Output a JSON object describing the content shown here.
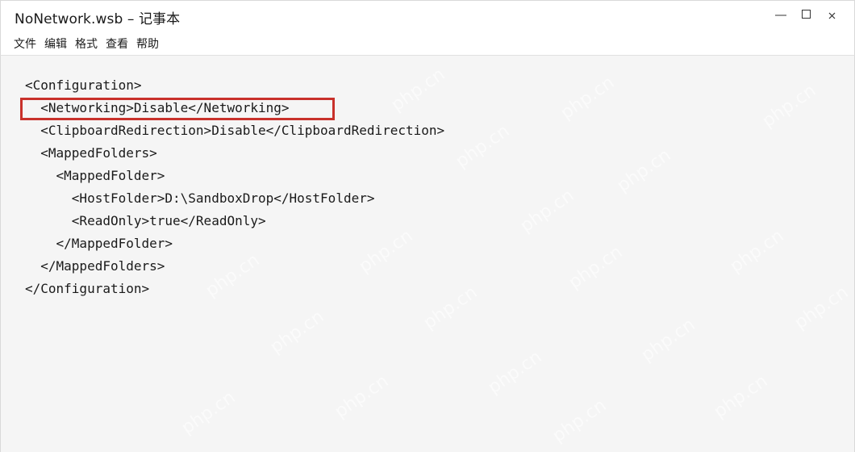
{
  "window": {
    "title": "NoNetwork.wsb – 记事本",
    "controls": {
      "minimize": "—",
      "maximize": "☐",
      "close": "✕"
    }
  },
  "menu": {
    "items": [
      "文件",
      "编辑",
      "格式",
      "查看",
      "帮助"
    ]
  },
  "editor": {
    "lines": [
      "<Configuration>",
      "  <Networking>Disable</Networking>",
      "  <ClipboardRedirection>Disable</ClipboardRedirection>",
      "  <MappedFolders>",
      "    <MappedFolder>",
      "      <HostFolder>D:\\SandboxDrop</HostFolder>",
      "      <ReadOnly>true</ReadOnly>",
      "    </MappedFolder>",
      "  </MappedFolders>",
      "</Configuration>"
    ],
    "highlighted_line_index": 1,
    "highlight_color": "#c8312b"
  },
  "watermark_text": "php.cn"
}
